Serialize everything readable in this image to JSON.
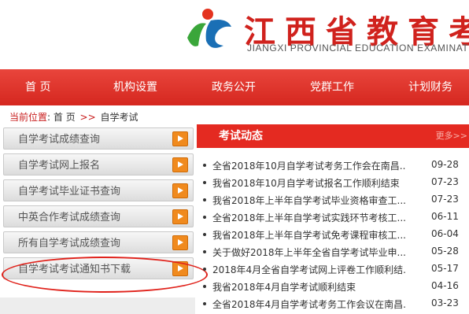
{
  "header": {
    "logo_text_cn": "江西省教育考",
    "logo_text_en": "JIANGXI PROVINCIAL EDUCATION EXAMINAT"
  },
  "nav": {
    "items": [
      "首 页",
      "机构设置",
      "政务公开",
      "党群工作",
      "计划财务"
    ]
  },
  "breadcrumb": {
    "label": "当前位置",
    "home": "首 页",
    "sep": ">>",
    "current": "自学考试"
  },
  "sidebar": {
    "items": [
      {
        "label": "自学考试成绩查询"
      },
      {
        "label": "自学考试网上报名"
      },
      {
        "label": "自学考试毕业证书查询"
      },
      {
        "label": "中英合作考试成绩查询"
      },
      {
        "label": "所有自学考试成绩查询"
      },
      {
        "label": "自学考试考试通知书下载"
      }
    ]
  },
  "news": {
    "title": "考试动态",
    "more": "更多>>",
    "items": [
      {
        "title": "全省2018年10月自学考试考务工作会在南昌...",
        "date": "09-28"
      },
      {
        "title": "我省2018年10月自学考试报名工作顺利结束",
        "date": "07-23"
      },
      {
        "title": "我省2018年上半年自学考试毕业资格审查工...",
        "date": "07-23"
      },
      {
        "title": "全省2018年上半年自学考试实践环节考核工...",
        "date": "06-11"
      },
      {
        "title": "我省2018年上半年自学考试免考课程审核工...",
        "date": "06-04"
      },
      {
        "title": "关于做好2018年上半年全省自学考试毕业申...",
        "date": "05-28"
      },
      {
        "title": "2018年4月全省自学考试网上评卷工作顺利结...",
        "date": "05-17"
      },
      {
        "title": "我省2018年4月自学考试顺利结束",
        "date": "04-16"
      },
      {
        "title": "全省2018年4月自学考试考务工作会议在南昌...",
        "date": "03-23"
      }
    ]
  },
  "colors": {
    "brand_red": "#e42a21",
    "arrow_orange": "#f08a1e",
    "logo_green": "#3aa63a",
    "logo_blue": "#1a6fb5"
  }
}
